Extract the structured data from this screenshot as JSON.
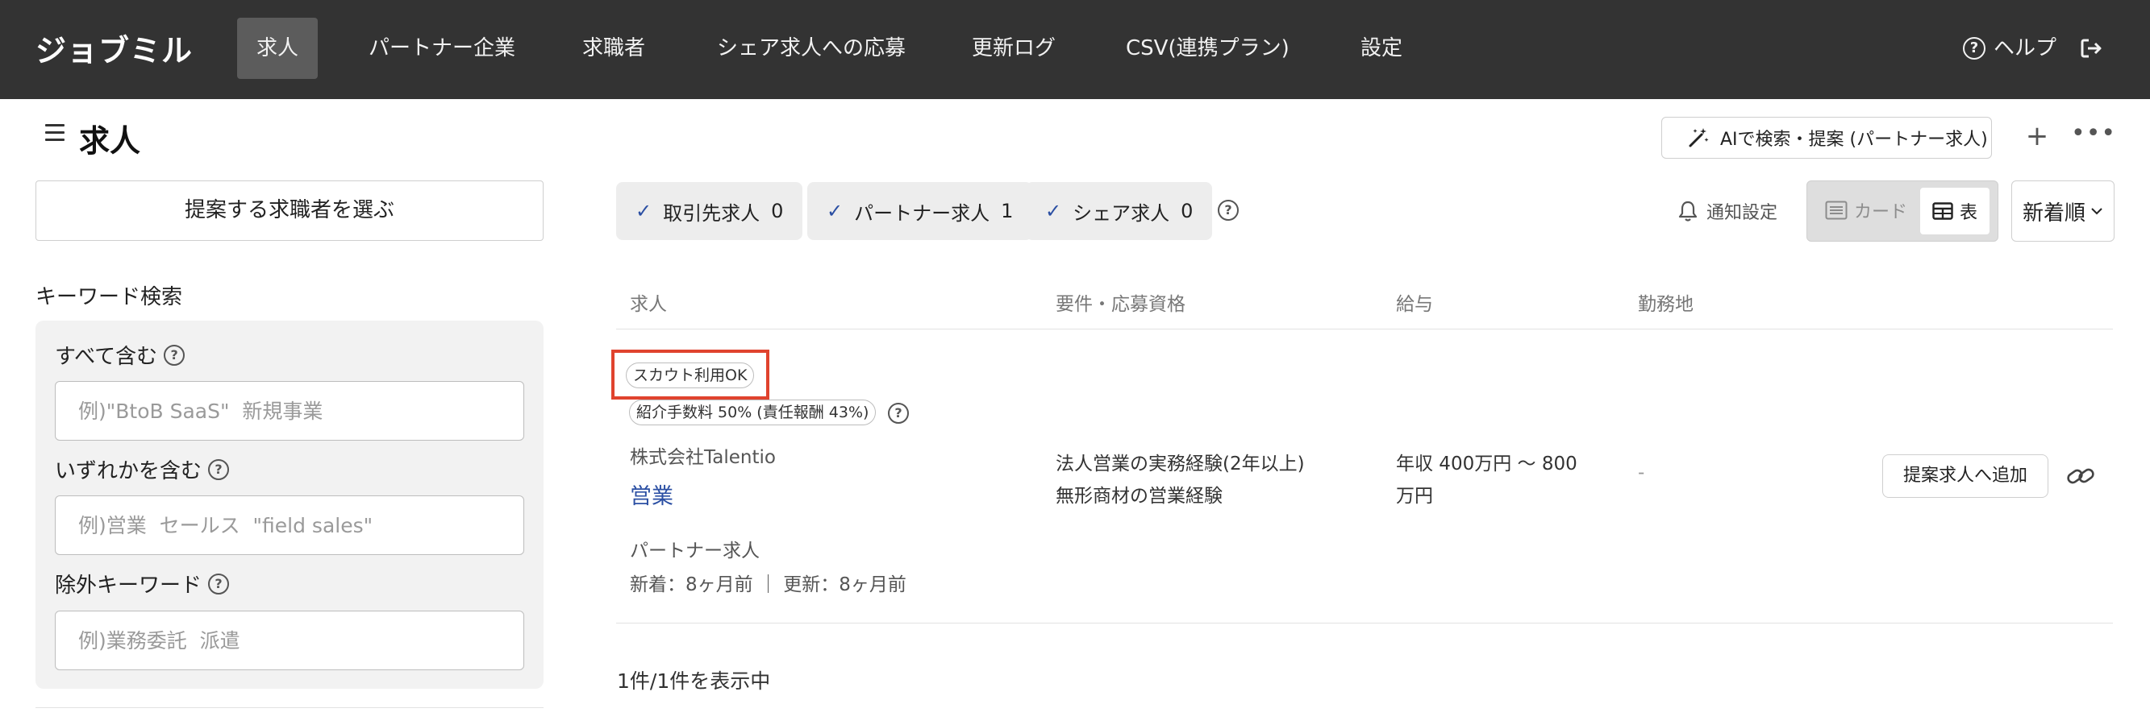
{
  "nav": {
    "brand": "ジョブミル",
    "items": [
      "求人",
      "パートナー企業",
      "求職者",
      "シェア求人への応募",
      "更新ログ",
      "CSV(連携プラン)",
      "設定"
    ],
    "active_index": 0,
    "help_label": "ヘルプ"
  },
  "page": {
    "title": "求人",
    "ai_button_label": "AIで検索・提案 (パートナー求人)",
    "plus_label": "+",
    "more_label": "•••"
  },
  "sidebar": {
    "select_seeker_label": "提案する求職者を選ぶ",
    "keyword_heading": "キーワード検索",
    "fields": [
      {
        "label": "すべて含む",
        "placeholder": "例)\"BtoB SaaS\"  新規事業",
        "value": ""
      },
      {
        "label": "いずれかを含む",
        "placeholder": "例)営業  セールス  \"field sales\"",
        "value": ""
      },
      {
        "label": "除外キーワード",
        "placeholder": "例)業務委託  派遣",
        "value": ""
      }
    ]
  },
  "filters": {
    "chips": [
      {
        "label": "取引先求人",
        "count": "0"
      },
      {
        "label": "パートナー求人",
        "count": "1"
      },
      {
        "label": "シェア求人",
        "count": "0"
      }
    ],
    "notify_label": "通知設定",
    "view_card_label": "カード",
    "view_table_label": "表",
    "sort_label": "新着順"
  },
  "table": {
    "headers": [
      "求人",
      "要件・応募資格",
      "給与",
      "勤務地"
    ],
    "rows": [
      {
        "scout_badge": "スカウト利用OK",
        "fee_badge": "紹介手数料 50% (責任報酬 43%)",
        "company": "株式会社Talentio",
        "title": "営業",
        "job_type": "パートナー求人",
        "dates": "新着：8ヶ月前 ｜ 更新：8ヶ月前",
        "requirements": [
          "法人営業の実務経験(2年以上)",
          "無形商材の営業経験"
        ],
        "salary": [
          "年収 400万円 〜 800",
          "万円"
        ],
        "location": "-",
        "add_button_label": "提案求人へ追加"
      }
    ]
  },
  "result_count": "1件/1件を表示中",
  "colors": {
    "nav_bg": "#333333",
    "accent_blue": "#2b4fa3",
    "highlight_red": "#e0432e"
  }
}
